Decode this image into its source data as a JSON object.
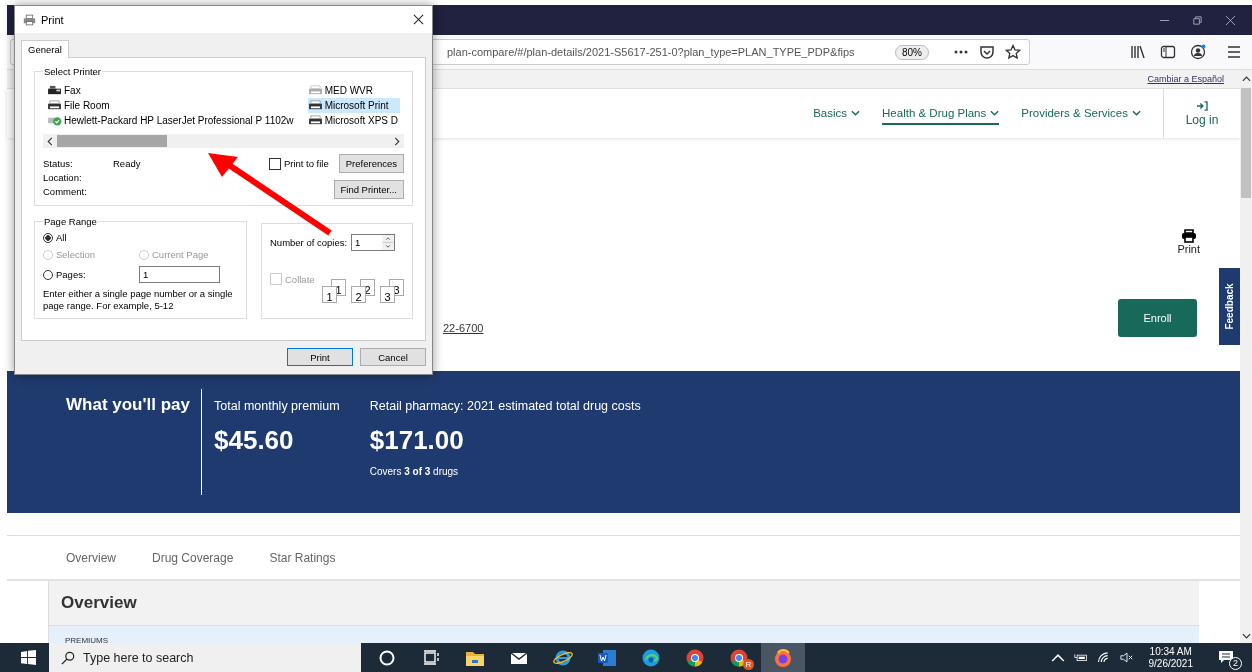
{
  "browser": {
    "url": "plan-compare/#/plan-details/2021-S5617-251-0?plan_type=PLAN_TYPE_PDP&fips",
    "zoom": "80%"
  },
  "site": {
    "language_link": "Cambiar a Español",
    "nav": [
      {
        "label": "Basics",
        "selected": false
      },
      {
        "label": "Health & Drug Plans",
        "selected": true
      },
      {
        "label": "Providers & Services",
        "selected": false
      }
    ],
    "login": "Log in",
    "print": "Print",
    "phone": "22-6700",
    "enroll": "Enroll",
    "feedback": "Feedback"
  },
  "banner": {
    "heading": "What you'll pay",
    "premium_label": "Total monthly premium",
    "premium": "$45.60",
    "drug_label": "Retail pharmacy: 2021 estimated total drug costs",
    "drug_cost": "$171.00",
    "drug_note": "Covers **3 of 3** drugs"
  },
  "tabs": [
    {
      "label": "Overview"
    },
    {
      "label": "Drug Coverage"
    },
    {
      "label": "Star Ratings"
    }
  ],
  "overview": {
    "title": "Overview",
    "row": "PREMIUMS"
  },
  "dialog": {
    "title": "Print",
    "tab": "General",
    "select_printer": "Select Printer",
    "printers": [
      {
        "name": "Fax",
        "kind": "fax",
        "selected": false
      },
      {
        "name": "File Room",
        "kind": "printer",
        "selected": false
      },
      {
        "name": "Hewlett-Packard HP LaserJet Professional P 1102w",
        "kind": "default",
        "selected": false
      },
      {
        "name": "MED WVR",
        "kind": "offline",
        "selected": false
      },
      {
        "name": "Microsoft Print",
        "kind": "printer",
        "selected": true
      },
      {
        "name": "Microsoft XPS D",
        "kind": "printer",
        "selected": false
      }
    ],
    "info": [
      {
        "label": "Status:",
        "value": "Ready"
      },
      {
        "label": "Location:"
      },
      {
        "label": "Comment:"
      }
    ],
    "print_to_file": {
      "label": "Print to file",
      "checked": false
    },
    "preferences": "Preferences",
    "find_printer": "Find Printer...",
    "page_range": "Page Range",
    "options": [
      {
        "label": "All",
        "selected": true,
        "disabled": false
      },
      {
        "label": "Selection",
        "selected": false,
        "disabled": true
      },
      {
        "label": "Current Page",
        "selected": false,
        "disabled": true
      },
      {
        "label": "Pages:",
        "selected": false,
        "disabled": false
      }
    ],
    "pages_value": "1",
    "hint": "Enter either a single page number or a single page range.  For example, 5-12",
    "copies_label": "Number of copies:",
    "copies": "1",
    "collate": {
      "label": "Collate",
      "checked": false,
      "disabled": true
    },
    "collate_stacks": [
      {
        "back": "1",
        "front": "1"
      },
      {
        "back": "2",
        "front": "2"
      },
      {
        "back": "3",
        "front": "3"
      }
    ],
    "print_button": "Print",
    "cancel_button": "Cancel"
  },
  "taskbar": {
    "search_placeholder": "Type here to search",
    "apps": [
      {
        "kind": "cortana",
        "active": false
      },
      {
        "kind": "taskview",
        "active": false
      },
      {
        "kind": "explorer",
        "active": false
      },
      {
        "kind": "mail",
        "active": false
      },
      {
        "kind": "ie",
        "active": false
      },
      {
        "kind": "word",
        "active": false
      },
      {
        "kind": "edge",
        "active": false
      },
      {
        "kind": "chrome",
        "active": false
      },
      {
        "kind": "chrome",
        "active": false,
        "badge": "R"
      },
      {
        "kind": "firefox",
        "active": true
      }
    ],
    "time": "10:34 AM",
    "date": "9/26/2021",
    "notifications": "2"
  }
}
